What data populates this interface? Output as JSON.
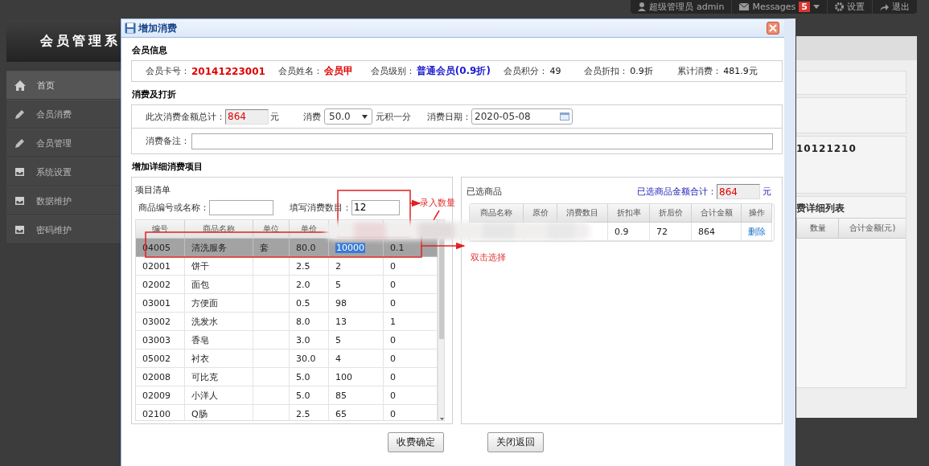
{
  "topbar": {
    "user": "超级管理员 admin",
    "messages_label": "Messages",
    "messages_count": "5",
    "settings": "设置",
    "logout": "退出"
  },
  "app_title": "会员管理系",
  "sidebar": {
    "items": [
      {
        "label": "首页",
        "kind": "home",
        "selected": true
      },
      {
        "label": "会员消费",
        "kind": "pencil",
        "selected": false
      },
      {
        "label": "会员管理",
        "kind": "pencil",
        "selected": false
      },
      {
        "label": "系统设置",
        "kind": "tray",
        "selected": false
      },
      {
        "label": "数据维护",
        "kind": "tray",
        "selected": false
      },
      {
        "label": "密码维护",
        "kind": "tray",
        "selected": false
      }
    ]
  },
  "background_panel": {
    "code": "10121210",
    "section_title": "费详细列表",
    "columns": [
      "数量",
      "合计金额(元)"
    ]
  },
  "dialog": {
    "title": "增加消费",
    "member_section": "会员信息",
    "member_fields": [
      {
        "label": "会员卡号：",
        "value": "20141223001",
        "kind": "alert"
      },
      {
        "label": "会员姓名：",
        "value": "会员甲",
        "kind": "alert"
      },
      {
        "label": "会员级别：",
        "value": "普通会员(0.9折)",
        "kind": "link"
      },
      {
        "label": "会员积分：",
        "value": "49",
        "kind": "plain"
      },
      {
        "label": "会员折扣：",
        "value": "0.9折",
        "kind": "plain"
      },
      {
        "label": "累计消费：",
        "value": "481.9元",
        "kind": "plain"
      }
    ],
    "consume_section": "消费及打折",
    "consume": {
      "total_label": "此次消费金额总计：",
      "total_value": "864",
      "total_unit": "元",
      "points_label": "消费",
      "points_value": "50.0",
      "points_suffix": "元积一分",
      "date_label": "消费日期：",
      "date_value": "2020-05-08",
      "note_label": "消费备注："
    },
    "detail_section": "增加详细消费项目",
    "item_list": {
      "title": "项目清单",
      "search_label": "商品编号或名称：",
      "quantity_label": "填写消费数目：",
      "quantity_value": "12",
      "columns": [
        "编号",
        "商品名称",
        "单位",
        "单价"
      ],
      "rows": [
        {
          "code": "04005",
          "name": "清洗服务",
          "unit": "套",
          "price": "80.0",
          "column_5": "10000",
          "column_6": "0.1",
          "selected": true,
          "value_highlighted": true
        },
        {
          "code": "02001",
          "name": "饼干",
          "price": "2.5",
          "column_5": "2",
          "column_6": "0",
          "selected": false,
          "value_highlighted": false
        },
        {
          "code": "02002",
          "name": "面包",
          "price": "2.0",
          "column_5": "5",
          "column_6": "0",
          "selected": false,
          "value_highlighted": false
        },
        {
          "code": "03001",
          "name": "方便面",
          "price": "0.5",
          "column_5": "98",
          "column_6": "0",
          "selected": false,
          "value_highlighted": false
        },
        {
          "code": "03002",
          "name": "洗发水",
          "price": "8.0",
          "column_5": "13",
          "column_6": "1",
          "selected": false,
          "value_highlighted": false
        },
        {
          "code": "03003",
          "name": "香皂",
          "price": "3.0",
          "column_5": "5",
          "column_6": "0",
          "selected": false,
          "value_highlighted": false
        },
        {
          "code": "05002",
          "name": "衬衣",
          "price": "30.0",
          "column_5": "4",
          "column_6": "0",
          "selected": false,
          "value_highlighted": false
        },
        {
          "code": "02008",
          "name": "可比克",
          "price": "5.0",
          "column_5": "100",
          "column_6": "0",
          "selected": false,
          "value_highlighted": false
        },
        {
          "code": "02009",
          "name": "小洋人",
          "price": "5.0",
          "column_5": "85",
          "column_6": "0",
          "selected": false,
          "value_highlighted": false
        },
        {
          "code": "02100",
          "name": "Q肠",
          "price": "2.5",
          "column_5": "65",
          "column_6": "0",
          "selected": false,
          "value_highlighted": false
        }
      ]
    },
    "selected_goods": {
      "title": "已选商品",
      "total_label": "已选商品金额合计：",
      "total_value": "864",
      "total_unit": "元",
      "columns": [
        "商品名称",
        "原价",
        "消费数目",
        "折扣率",
        "折后价",
        "合计金额",
        "操作"
      ],
      "rows": [
        {
          "discount_rate": "0.9",
          "discounted_price": "72",
          "amount": "864",
          "action": "删除"
        }
      ]
    },
    "buttons": [
      "收费确定",
      "关闭返回"
    ]
  },
  "annotations": [
    "录入数量",
    "双击选择"
  ]
}
